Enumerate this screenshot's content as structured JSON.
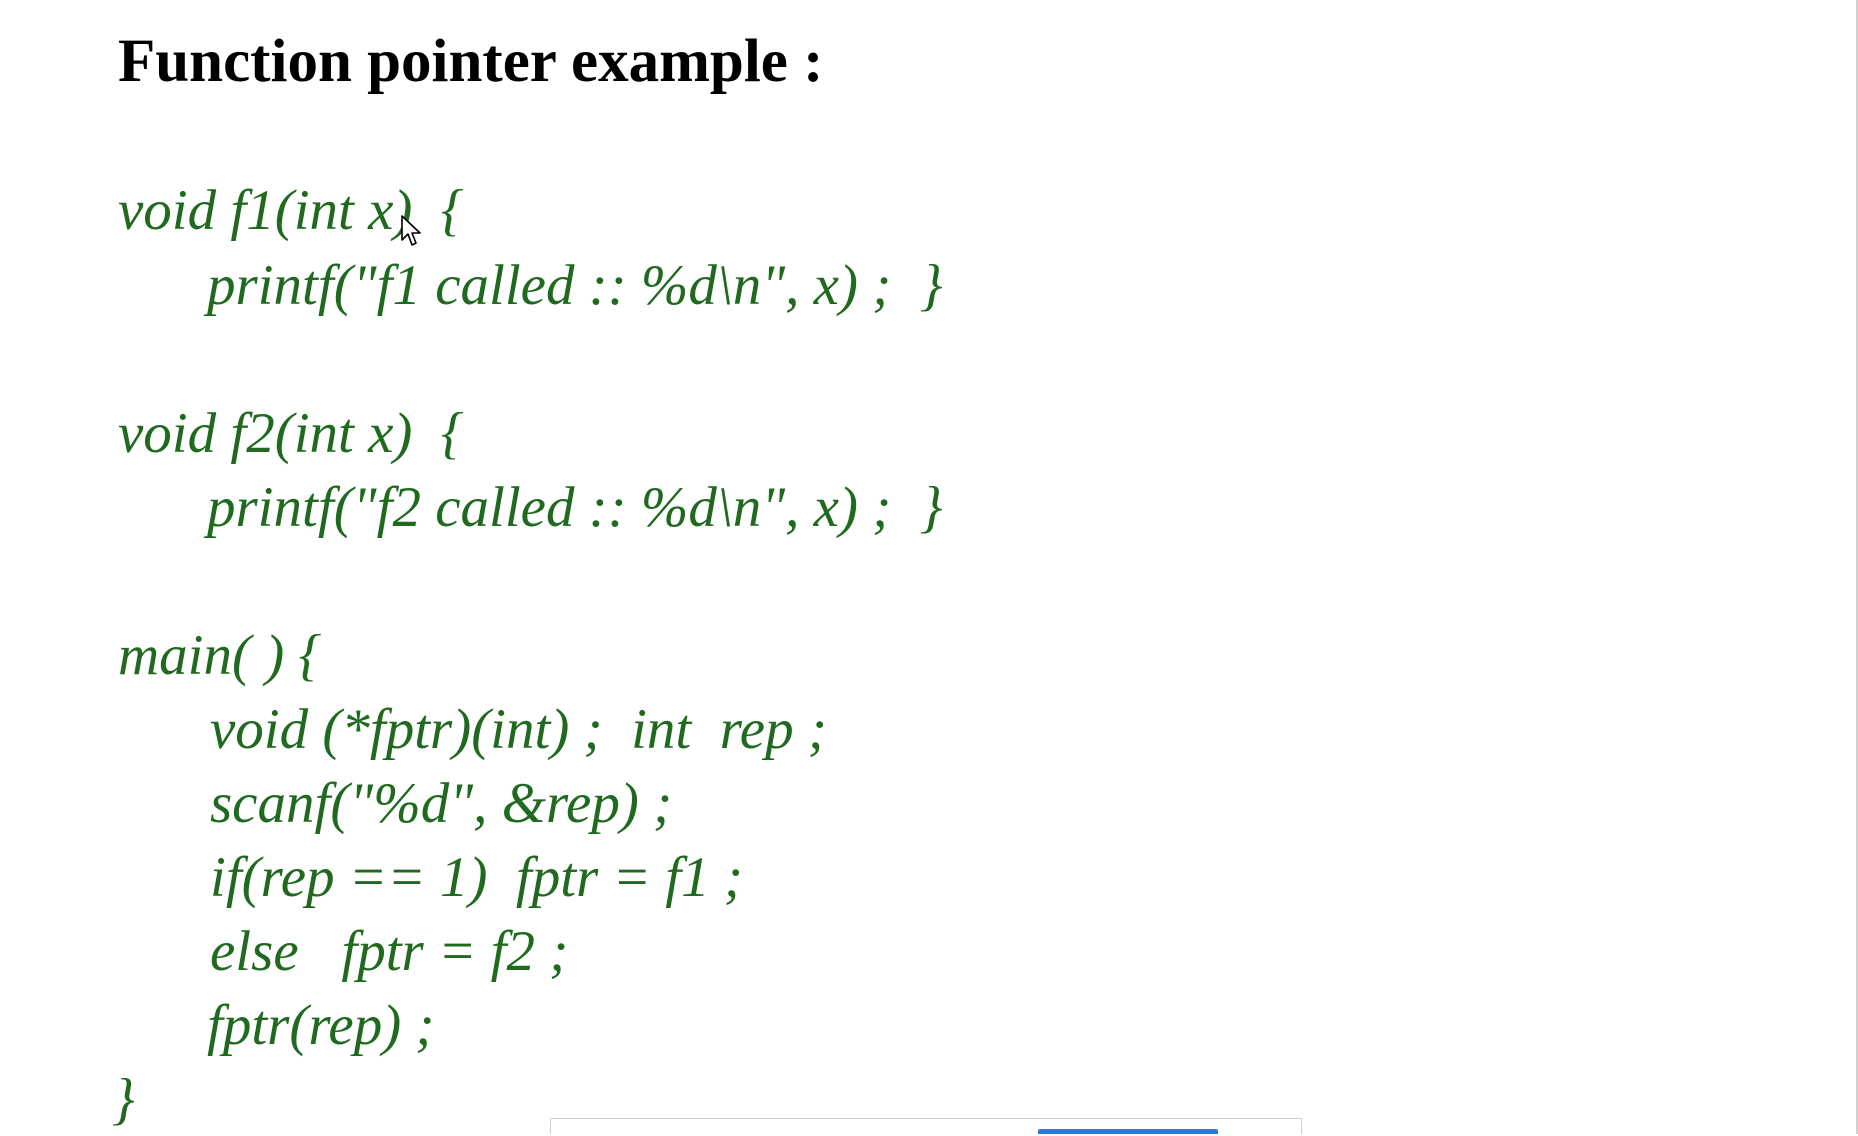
{
  "slide": {
    "title": "Function pointer example :",
    "code_lines": [
      "void f1(int x)  {",
      "printf(\"f1 called :: %d\\n\", x) ;  }",
      "void f2(int x)  {",
      "printf(\"f2 called :: %d\\n\", x) ;  }",
      "main( ) {",
      "void (*fptr)(int) ;  int  rep ;",
      "scanf(\"%d\", &rep) ;",
      "if(rep == 1)  fptr = f1 ;",
      "else   fptr = f2 ;",
      "fptr(rep) ;",
      "}"
    ]
  },
  "colors": {
    "code_text": "#1f6a1f",
    "title_text": "#000000",
    "background": "#ffffff",
    "bottom_bar_accent": "#2f78d6"
  },
  "icons": {
    "cursor": "mouse-pointer-icon"
  }
}
